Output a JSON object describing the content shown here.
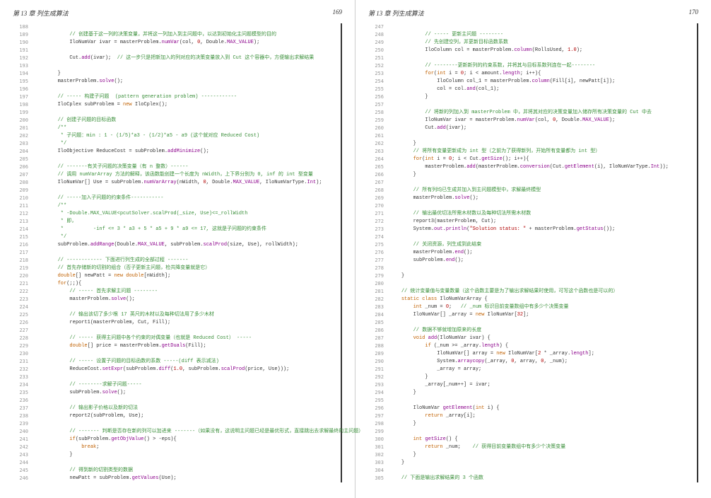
{
  "header": {
    "chapter": "第 13 章    列生成算法",
    "page_left": "169",
    "page_right": "170"
  },
  "left_start_line": 188,
  "right_start_line": 247,
  "left_lines": [
    [],
    [
      [
        "sp",
        "            "
      ],
      [
        "comment",
        "// 创建基于这一列的决策变量，并将这一列加入到主问题中，以达到初始化主问题模型的目的"
      ]
    ],
    [
      [
        "sp",
        "            "
      ],
      [
        "ident",
        "IloNumVar ivar = masterProblem."
      ],
      [
        "func",
        "numVar"
      ],
      [
        "ident",
        "(col, "
      ],
      [
        "number",
        "0"
      ],
      [
        "ident",
        ", Double."
      ],
      [
        "const",
        "MAX_VALUE"
      ],
      [
        "ident",
        ");"
      ]
    ],
    [],
    [
      [
        "sp",
        "            "
      ],
      [
        "ident",
        "Cut."
      ],
      [
        "func",
        "add"
      ],
      [
        "ident",
        "(ivar);  "
      ],
      [
        "comment",
        "// 这一步只是把新加入的列对应的决策变量放入到 Cut 这个容器中，方便输出求解结果"
      ]
    ],
    [],
    [
      [
        "sp",
        "        "
      ],
      [
        "ident",
        "}"
      ]
    ],
    [
      [
        "sp",
        "        "
      ],
      [
        "ident",
        "masterProblem."
      ],
      [
        "func",
        "solve"
      ],
      [
        "ident",
        "();"
      ]
    ],
    [],
    [
      [
        "sp",
        "        "
      ],
      [
        "comment",
        "// ----- 构建子问题  (pattern generation problem) ------------"
      ]
    ],
    [
      [
        "sp",
        "        "
      ],
      [
        "ident",
        "IloCplex subProblem = "
      ],
      [
        "keyword",
        "new"
      ],
      [
        "ident",
        " IloCplex();"
      ]
    ],
    [],
    [
      [
        "sp",
        "        "
      ],
      [
        "comment",
        "// 创建子问题的目标函数"
      ]
    ],
    [
      [
        "sp",
        "        "
      ],
      [
        "comment",
        "/**"
      ]
    ],
    [
      [
        "sp",
        "        "
      ],
      [
        "comment",
        " * 子问题：min : 1 - (1/5)*a3 - (1/2)*a5 - a9 (这个就对应 Reduced Cost)"
      ]
    ],
    [
      [
        "sp",
        "        "
      ],
      [
        "comment",
        " */"
      ]
    ],
    [
      [
        "sp",
        "        "
      ],
      [
        "ident",
        "IloObjective ReduceCost = subProblem."
      ],
      [
        "func",
        "addMinimize"
      ],
      [
        "ident",
        "();"
      ]
    ],
    [],
    [
      [
        "sp",
        "        "
      ],
      [
        "comment",
        "// -------有关子问题的决策变量（有 n 整数）------"
      ]
    ],
    [
      [
        "sp",
        "        "
      ],
      [
        "comment",
        "// 调用 numVarArray 方法的解释，该函数能创建一个长度为 nWidth，上下界分别为 0, inf 的 int 型变量"
      ]
    ],
    [
      [
        "sp",
        "        "
      ],
      [
        "ident",
        "IloNumVar[] Use = subProblem."
      ],
      [
        "func",
        "numVarArray"
      ],
      [
        "ident",
        "(nWidth, "
      ],
      [
        "number",
        "0"
      ],
      [
        "ident",
        ", Double."
      ],
      [
        "const",
        "MAX_VALUE"
      ],
      [
        "ident",
        ", IloNumVarType."
      ],
      [
        "const",
        "Int"
      ],
      [
        "ident",
        ");"
      ]
    ],
    [],
    [
      [
        "sp",
        "        "
      ],
      [
        "comment",
        "// -----加入子问题的约束条件-----------"
      ]
    ],
    [
      [
        "sp",
        "        "
      ],
      [
        "comment",
        "/**"
      ]
    ],
    [
      [
        "sp",
        "        "
      ],
      [
        "comment",
        " * -Double.MAX_VALUE<pcutSolver.scalProd(_size, Use)<=_rollWidth"
      ]
    ],
    [
      [
        "sp",
        "        "
      ],
      [
        "comment",
        " * 即，"
      ]
    ],
    [
      [
        "sp",
        "        "
      ],
      [
        "comment",
        " *          -inf <= 3 * a3 + 5 * a5 + 9 * a9 <= 17, 这就是子问题的约束条件"
      ]
    ],
    [
      [
        "sp",
        "        "
      ],
      [
        "comment",
        " */"
      ]
    ],
    [
      [
        "sp",
        "        "
      ],
      [
        "ident",
        "subProblem."
      ],
      [
        "func",
        "addRange"
      ],
      [
        "ident",
        "(Double."
      ],
      [
        "const",
        "MAX_VALUE"
      ],
      [
        "ident",
        ", subProblem."
      ],
      [
        "func",
        "scalProd"
      ],
      [
        "ident",
        "(size, Use), rollWidth);"
      ]
    ],
    [],
    [
      [
        "sp",
        "        "
      ],
      [
        "comment",
        "// ------------ 下面进行列生成的全部过程 -------"
      ]
    ],
    [
      [
        "sp",
        "        "
      ],
      [
        "comment",
        "// 首先存储新的切割的组合（否子更新主问题，检共降变量就是它）"
      ]
    ],
    [
      [
        "sp",
        "        "
      ],
      [
        "keyword",
        "double"
      ],
      [
        "ident",
        "[] newPatt = "
      ],
      [
        "keyword",
        "new"
      ],
      [
        "ident",
        " "
      ],
      [
        "keyword",
        "double"
      ],
      [
        "ident",
        "[nWidth];"
      ]
    ],
    [
      [
        "sp",
        "        "
      ],
      [
        "keyword",
        "for"
      ],
      [
        "ident",
        "(;;){"
      ]
    ],
    [
      [
        "sp",
        "            "
      ],
      [
        "comment",
        "// ----- 首先求解主问题 --------"
      ]
    ],
    [
      [
        "sp",
        "            "
      ],
      [
        "ident",
        "masterProblem."
      ],
      [
        "func",
        "solve"
      ],
      [
        "ident",
        "();"
      ]
    ],
    [],
    [
      [
        "sp",
        "            "
      ],
      [
        "comment",
        "// 输出该切了多少根 17 英尺的木材以及每种切法用了多少木材"
      ]
    ],
    [
      [
        "sp",
        "            "
      ],
      [
        "ident",
        "report1(masterProblem, Cut, Fill);"
      ]
    ],
    [],
    [
      [
        "sp",
        "            "
      ],
      [
        "comment",
        "// ----- 获得主问题中各个约束的对偶变量（也就是 Reduced Cost） -----"
      ]
    ],
    [
      [
        "sp",
        "            "
      ],
      [
        "keyword",
        "double"
      ],
      [
        "ident",
        "[] price = masterProblem."
      ],
      [
        "func",
        "getDuals"
      ],
      [
        "ident",
        "(Fill);"
      ]
    ],
    [],
    [
      [
        "sp",
        "            "
      ],
      [
        "comment",
        "// ----- 设置子问题的目标函数的系数 -----(diff 表示减法)"
      ]
    ],
    [
      [
        "sp",
        "            "
      ],
      [
        "ident",
        "ReduceCost."
      ],
      [
        "func",
        "setExpr"
      ],
      [
        "ident",
        "(subProblem."
      ],
      [
        "func",
        "diff"
      ],
      [
        "ident",
        "("
      ],
      [
        "number",
        "1.0"
      ],
      [
        "ident",
        ", subProblem."
      ],
      [
        "func",
        "scalProd"
      ],
      [
        "ident",
        "(price, Use)));"
      ]
    ],
    [],
    [
      [
        "sp",
        "            "
      ],
      [
        "comment",
        "// --------求解子问题-----"
      ]
    ],
    [
      [
        "sp",
        "            "
      ],
      [
        "ident",
        "subProblem."
      ],
      [
        "func",
        "solve"
      ],
      [
        "ident",
        "();"
      ]
    ],
    [],
    [
      [
        "sp",
        "            "
      ],
      [
        "comment",
        "// 输出影子价格以及新的切法"
      ]
    ],
    [
      [
        "sp",
        "            "
      ],
      [
        "ident",
        "report2(subProblem, Use);"
      ]
    ],
    [],
    [
      [
        "sp",
        "            "
      ],
      [
        "comment",
        "// ------- 判断是否存在新的列可以加进来 -------（如果没有，这说明主问题已经是最优形式，直接跳出去求解最终的主问题）"
      ]
    ],
    [
      [
        "sp",
        "            "
      ],
      [
        "keyword",
        "if"
      ],
      [
        "ident",
        "(subProblem."
      ],
      [
        "func",
        "getObjValue"
      ],
      [
        "ident",
        "() > -eps){"
      ]
    ],
    [
      [
        "sp",
        "                "
      ],
      [
        "keyword",
        "break"
      ],
      [
        "ident",
        ";"
      ]
    ],
    [
      [
        "sp",
        "            "
      ],
      [
        "ident",
        "}"
      ]
    ],
    [],
    [
      [
        "sp",
        "            "
      ],
      [
        "comment",
        "// 得到新的切割类型的数据"
      ]
    ],
    [
      [
        "sp",
        "            "
      ],
      [
        "ident",
        "newPatt = subProblem."
      ],
      [
        "func",
        "getValues"
      ],
      [
        "ident",
        "(Use);"
      ]
    ]
  ],
  "right_lines": [
    [],
    [
      [
        "sp",
        "            "
      ],
      [
        "comment",
        "// ----- 更新主问题 --------"
      ]
    ],
    [
      [
        "sp",
        "            "
      ],
      [
        "comment",
        "// 先创建空列，并更新目标函数系数"
      ]
    ],
    [
      [
        "sp",
        "            "
      ],
      [
        "ident",
        "IloColumn col = masterProblem."
      ],
      [
        "func",
        "column"
      ],
      [
        "ident",
        "(RollsUsed, "
      ],
      [
        "number",
        "1.0"
      ],
      [
        "ident",
        ");"
      ]
    ],
    [],
    [
      [
        "sp",
        "            "
      ],
      [
        "comment",
        "// --------更新新列的约束系数，并将其与目标系数列连在一起--------"
      ]
    ],
    [
      [
        "sp",
        "            "
      ],
      [
        "keyword",
        "for"
      ],
      [
        "ident",
        "("
      ],
      [
        "keyword",
        "int"
      ],
      [
        "ident",
        " i = "
      ],
      [
        "number",
        "0"
      ],
      [
        "ident",
        "; i < amount."
      ],
      [
        "const",
        "length"
      ],
      [
        "ident",
        "; i++){"
      ]
    ],
    [
      [
        "sp",
        "                "
      ],
      [
        "ident",
        "IloColumn col_1 = masterProblem."
      ],
      [
        "func",
        "column"
      ],
      [
        "ident",
        "(Fill[i], newPatt[i]);"
      ]
    ],
    [
      [
        "sp",
        "                "
      ],
      [
        "ident",
        "col = col."
      ],
      [
        "func",
        "and"
      ],
      [
        "ident",
        "(col_1);"
      ]
    ],
    [
      [
        "sp",
        "            "
      ],
      [
        "ident",
        "}"
      ]
    ],
    [],
    [
      [
        "sp",
        "            "
      ],
      [
        "comment",
        "// 将新的列加入到 masterProblem 中，并将其对应的决策变量加入储存所有决策变量的 Cut 中去"
      ]
    ],
    [
      [
        "sp",
        "            "
      ],
      [
        "ident",
        "IloNumVar ivar = masterProblem."
      ],
      [
        "func",
        "numVar"
      ],
      [
        "ident",
        "(col, "
      ],
      [
        "number",
        "0"
      ],
      [
        "ident",
        ", Double."
      ],
      [
        "const",
        "MAX_VALUE"
      ],
      [
        "ident",
        ");"
      ]
    ],
    [
      [
        "sp",
        "            "
      ],
      [
        "ident",
        "Cut."
      ],
      [
        "func",
        "add"
      ],
      [
        "ident",
        "(ivar);"
      ]
    ],
    [],
    [
      [
        "sp",
        "        "
      ],
      [
        "ident",
        "}"
      ]
    ],
    [
      [
        "sp",
        "        "
      ],
      [
        "comment",
        "// 将所有变量更新成为 int 型（之前为了获得新列，开始所有变量都为 int 型）"
      ]
    ],
    [
      [
        "sp",
        "        "
      ],
      [
        "keyword",
        "for"
      ],
      [
        "ident",
        "("
      ],
      [
        "keyword",
        "int"
      ],
      [
        "ident",
        " i = "
      ],
      [
        "number",
        "0"
      ],
      [
        "ident",
        "; i < Cut."
      ],
      [
        "func",
        "getSize"
      ],
      [
        "ident",
        "(); i++){"
      ]
    ],
    [
      [
        "sp",
        "            "
      ],
      [
        "ident",
        "masterProblem."
      ],
      [
        "func",
        "add"
      ],
      [
        "ident",
        "(masterProblem."
      ],
      [
        "func",
        "conversion"
      ],
      [
        "ident",
        "(Cut."
      ],
      [
        "func",
        "getElement"
      ],
      [
        "ident",
        "(i), IloNumVarType."
      ],
      [
        "const",
        "Int"
      ],
      [
        "ident",
        "));"
      ]
    ],
    [
      [
        "sp",
        "        "
      ],
      [
        "ident",
        "}"
      ]
    ],
    [],
    [
      [
        "sp",
        "        "
      ],
      [
        "comment",
        "// 所有列均已生成并加入到主问题模型中，求解最终模型"
      ]
    ],
    [
      [
        "sp",
        "        "
      ],
      [
        "ident",
        "masterProblem."
      ],
      [
        "func",
        "solve"
      ],
      [
        "ident",
        "();"
      ]
    ],
    [],
    [
      [
        "sp",
        "        "
      ],
      [
        "comment",
        "// 输出最优切法所需木材数以及每种切法所需木材数"
      ]
    ],
    [
      [
        "sp",
        "        "
      ],
      [
        "ident",
        "report3(masterProblem, Cut);"
      ]
    ],
    [
      [
        "sp",
        "        "
      ],
      [
        "ident",
        "System."
      ],
      [
        "const",
        "out"
      ],
      [
        "ident",
        "."
      ],
      [
        "func",
        "println"
      ],
      [
        "ident",
        "("
      ],
      [
        "string",
        "\"Solution status: \""
      ],
      [
        "ident",
        " + masterProblem."
      ],
      [
        "func",
        "getStatus"
      ],
      [
        "ident",
        "());"
      ]
    ],
    [],
    [
      [
        "sp",
        "        "
      ],
      [
        "comment",
        "// 关闭资源，列生成到此结束"
      ]
    ],
    [
      [
        "sp",
        "        "
      ],
      [
        "ident",
        "masterProblem."
      ],
      [
        "func",
        "end"
      ],
      [
        "ident",
        "();"
      ]
    ],
    [
      [
        "sp",
        "        "
      ],
      [
        "ident",
        "subProblem."
      ],
      [
        "func",
        "end"
      ],
      [
        "ident",
        "();"
      ]
    ],
    [],
    [
      [
        "sp",
        "    "
      ],
      [
        "ident",
        "}"
      ]
    ],
    [],
    [
      [
        "sp",
        "    "
      ],
      [
        "comment",
        "// 统计变量值与变量数量（这个函数主要是为了输出求解结果时使用，可写这个函数也是可以的）"
      ]
    ],
    [
      [
        "sp",
        "    "
      ],
      [
        "keyword",
        "static class"
      ],
      [
        "ident",
        " IloNumVarArray {"
      ]
    ],
    [
      [
        "sp",
        "        "
      ],
      [
        "keyword",
        "int"
      ],
      [
        "ident",
        " _num = "
      ],
      [
        "number",
        "0"
      ],
      [
        "ident",
        ";   "
      ],
      [
        "comment",
        "// _num 标识目前变量数组中有多少个决策变量"
      ]
    ],
    [
      [
        "sp",
        "        "
      ],
      [
        "ident",
        "IloNumVar[] _array = "
      ],
      [
        "keyword",
        "new"
      ],
      [
        "ident",
        " IloNumVar["
      ],
      [
        "number",
        "32"
      ],
      [
        "ident",
        "];"
      ]
    ],
    [],
    [
      [
        "sp",
        "        "
      ],
      [
        "comment",
        "// 数据不够就增加原来的长度"
      ]
    ],
    [
      [
        "sp",
        "        "
      ],
      [
        "keyword",
        "void"
      ],
      [
        "ident",
        " "
      ],
      [
        "func",
        "add"
      ],
      [
        "ident",
        "(IloNumVar ivar) {"
      ]
    ],
    [
      [
        "sp",
        "            "
      ],
      [
        "keyword",
        "if"
      ],
      [
        "ident",
        " (_num >= _array."
      ],
      [
        "const",
        "length"
      ],
      [
        "ident",
        ") {"
      ]
    ],
    [
      [
        "sp",
        "                "
      ],
      [
        "ident",
        "IloNumVar[] array = "
      ],
      [
        "keyword",
        "new"
      ],
      [
        "ident",
        " IloNumVar["
      ],
      [
        "number",
        "2"
      ],
      [
        "ident",
        " * _array."
      ],
      [
        "const",
        "length"
      ],
      [
        "ident",
        "];"
      ]
    ],
    [
      [
        "sp",
        "                "
      ],
      [
        "ident",
        "System."
      ],
      [
        "func",
        "arraycopy"
      ],
      [
        "ident",
        "(_array, "
      ],
      [
        "number",
        "0"
      ],
      [
        "ident",
        ", array, "
      ],
      [
        "number",
        "0"
      ],
      [
        "ident",
        ", _num);"
      ]
    ],
    [
      [
        "sp",
        "                "
      ],
      [
        "ident",
        "_array = array;"
      ]
    ],
    [
      [
        "sp",
        "            "
      ],
      [
        "ident",
        "}"
      ]
    ],
    [
      [
        "sp",
        "            "
      ],
      [
        "ident",
        "_array[_num++] = ivar;"
      ]
    ],
    [
      [
        "sp",
        "        "
      ],
      [
        "ident",
        "}"
      ]
    ],
    [],
    [
      [
        "sp",
        "        "
      ],
      [
        "ident",
        "IloNumVar "
      ],
      [
        "func",
        "getElement"
      ],
      [
        "ident",
        "("
      ],
      [
        "keyword",
        "int"
      ],
      [
        "ident",
        " i) {"
      ]
    ],
    [
      [
        "sp",
        "            "
      ],
      [
        "keyword",
        "return"
      ],
      [
        "ident",
        " _array[i];"
      ]
    ],
    [
      [
        "sp",
        "        "
      ],
      [
        "ident",
        "}"
      ]
    ],
    [],
    [
      [
        "sp",
        "        "
      ],
      [
        "keyword",
        "int"
      ],
      [
        "ident",
        " "
      ],
      [
        "func",
        "getSize"
      ],
      [
        "ident",
        "() {"
      ]
    ],
    [
      [
        "sp",
        "            "
      ],
      [
        "keyword",
        "return"
      ],
      [
        "ident",
        " _num;    "
      ],
      [
        "comment",
        "// 获得目前变量数组中有多少个决策变量"
      ]
    ],
    [
      [
        "sp",
        "        "
      ],
      [
        "ident",
        "}"
      ]
    ],
    [
      [
        "sp",
        "    "
      ],
      [
        "ident",
        "}"
      ]
    ],
    [],
    [
      [
        "sp",
        "    "
      ],
      [
        "comment",
        "// 下面是输出求解结果的 3 个函数"
      ]
    ]
  ]
}
